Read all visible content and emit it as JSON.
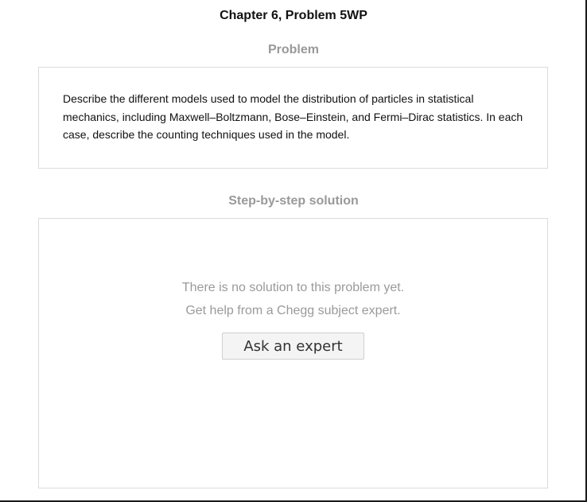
{
  "page": {
    "title": "Chapter 6, Problem 5WP"
  },
  "problem": {
    "heading": "Problem",
    "text": "Describe the different models used to model the distribution of particles in statistical mechanics, including Maxwell–Boltzmann, Bose–Einstein, and Fermi–Dirac statistics. In each case, describe the counting techniques used in the model."
  },
  "solution": {
    "heading": "Step-by-step solution",
    "empty_line_1": "There is no solution to this problem yet.",
    "empty_line_2": "Get help from a Chegg subject expert.",
    "ask_button_label": "Ask an expert"
  },
  "colors": {
    "heading_gray": "#999999",
    "border_gray": "#dcdcdc",
    "button_bg": "#f4f4f4"
  }
}
